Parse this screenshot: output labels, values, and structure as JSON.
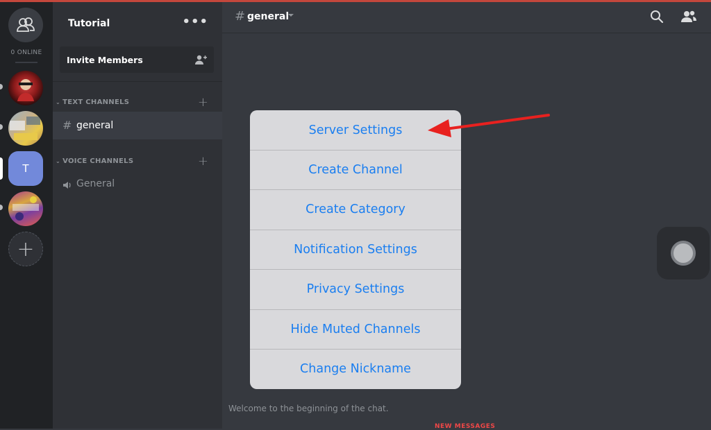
{
  "guilds": {
    "online_label": "0 ONLINE",
    "items": [
      {
        "name": "avatar-red"
      },
      {
        "name": "avatar-game"
      },
      {
        "name": "tutorial",
        "initial": "T"
      },
      {
        "name": "avatar-purple"
      }
    ]
  },
  "server": {
    "name": "Tutorial",
    "invite_label": "Invite Members"
  },
  "channels": {
    "text_category": "TEXT CHANNELS",
    "voice_category": "VOICE CHANNELS",
    "text_items": [
      {
        "label": "general"
      }
    ],
    "voice_items": [
      {
        "label": "General"
      }
    ]
  },
  "main": {
    "channel_name": "general",
    "welcome_text": "Welcome to the beginning of the chat.",
    "new_messages": "NEW MESSAGES"
  },
  "menu": {
    "items": [
      {
        "label": "Server Settings"
      },
      {
        "label": "Create Channel"
      },
      {
        "label": "Create Category"
      },
      {
        "label": "Notification Settings"
      },
      {
        "label": "Privacy Settings"
      },
      {
        "label": "Hide Muted Channels"
      },
      {
        "label": "Change Nickname"
      }
    ],
    "text_color": "#1a7ef0",
    "background": "#d9d9dc"
  },
  "colors": {
    "arrow": "#e8211f",
    "accent": "#7289da"
  }
}
